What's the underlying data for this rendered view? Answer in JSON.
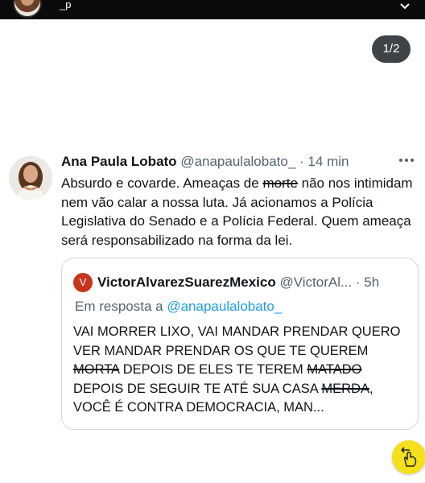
{
  "topbar": {
    "handle_partial": "_p"
  },
  "pagination": {
    "label": "1/2"
  },
  "tweet": {
    "author_name": "Ana Paula Lobato",
    "author_handle": "@anapaulalobato_",
    "time": "· 14 min",
    "text_part1": "Absurdo e covarde. Ameaças de ",
    "text_struck": "morte",
    "text_part2": " não nos intimidam nem vão calar a nossa luta. Já acionamos a Polícia Legislativa do Senado e a Polícia Federal. Quem ameaça será responsabilizado na forma da lei."
  },
  "quote": {
    "avatar_letter": "V",
    "author_name": "VictorAlvarezSuarezMexico",
    "author_handle": "@VictorAl...",
    "time": "· 5h",
    "reply_prefix": "Em resposta a ",
    "reply_mention": "@anapaulalobato_",
    "line1": "VAI MORRER LIXO, VAI MANDAR PRENDAR QUERO VER MANDAR PRENDAR OS QUE TE QUEREM ",
    "struck1": "MORTA",
    "line2": " DEPOIS DE ELES TE TEREM ",
    "struck2": "MATADO",
    "line3": " DEPOIS DE SEGUIR TE ATÉ SUA CASA ",
    "struck3": "MERDA",
    "line4": ", VOCÊ É CONTRA DEMOCRACIA, MAN..."
  },
  "colors": {
    "accent": "#1d9bf0",
    "fab": "#f4e01b"
  }
}
